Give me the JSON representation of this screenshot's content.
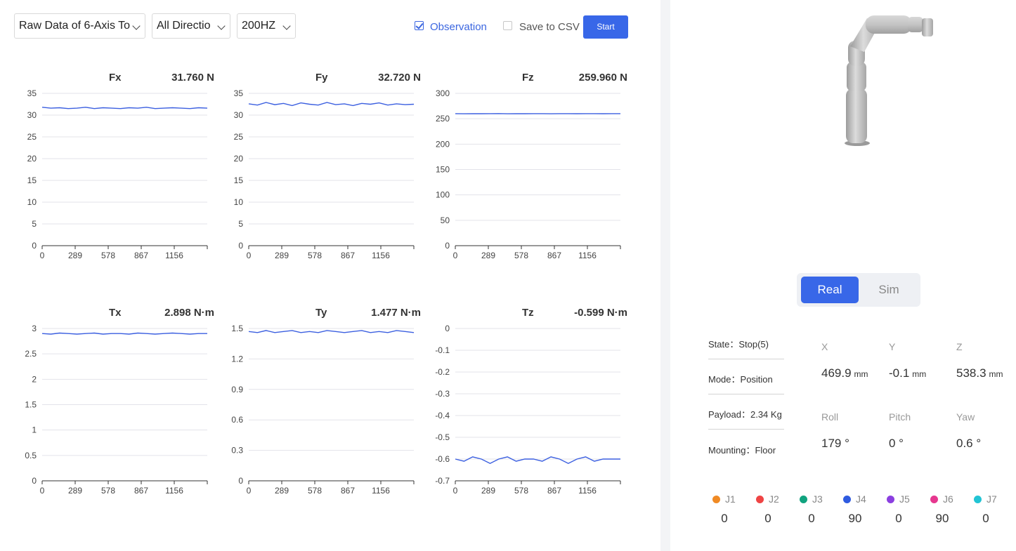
{
  "toolbar": {
    "data_select": "Raw Data of 6-Axis To",
    "direction_select": "All Directio",
    "rate_select": "200HZ",
    "observation_label": "Observation",
    "observation_checked": true,
    "save_csv_label": "Save to CSV",
    "save_csv_checked": false,
    "start_label": "Start"
  },
  "colors": {
    "accent": "#3867e8",
    "line": "#3b5fe0"
  },
  "chart_data": [
    {
      "type": "line",
      "title": "Fx",
      "value_label": "31.760 N",
      "ylim": [
        0,
        35
      ],
      "yticks": [
        "35",
        "30",
        "25",
        "20",
        "15",
        "10",
        "5",
        "0"
      ],
      "xticks": [
        "0",
        "289",
        "578",
        "867",
        "1156"
      ],
      "xmax": 1445,
      "series": [
        {
          "values": [
            31.8,
            31.6,
            31.7,
            31.5,
            31.6,
            31.8,
            31.5,
            31.7,
            31.6,
            31.5,
            31.7,
            31.6,
            31.8,
            31.5,
            31.6,
            31.7,
            31.6,
            31.5,
            31.7,
            31.6
          ]
        }
      ]
    },
    {
      "type": "line",
      "title": "Fy",
      "value_label": "32.720 N",
      "ylim": [
        0,
        35
      ],
      "yticks": [
        "35",
        "30",
        "25",
        "20",
        "15",
        "10",
        "5",
        "0"
      ],
      "xticks": [
        "0",
        "289",
        "578",
        "867",
        "1156"
      ],
      "xmax": 1445,
      "series": [
        {
          "values": [
            32.6,
            32.3,
            32.9,
            32.4,
            32.7,
            32.2,
            32.8,
            32.5,
            32.3,
            32.9,
            32.4,
            32.6,
            32.2,
            32.7,
            32.5,
            32.8,
            32.3,
            32.6,
            32.4,
            32.5
          ]
        }
      ]
    },
    {
      "type": "line",
      "title": "Fz",
      "value_label": "259.960 N",
      "ylim": [
        0,
        300
      ],
      "yticks": [
        "300",
        "250",
        "200",
        "150",
        "100",
        "50",
        "0"
      ],
      "xticks": [
        "0",
        "289",
        "578",
        "867",
        "1156"
      ],
      "xmax": 1445,
      "series": [
        {
          "values": [
            260,
            259.8,
            260.1,
            259.9,
            260,
            260.2,
            259.8,
            260,
            259.9,
            260.1,
            260,
            259.8,
            260,
            260.1,
            259.9,
            260,
            260.1,
            259.9,
            260,
            260
          ]
        }
      ]
    },
    {
      "type": "line",
      "title": "Tx",
      "value_label": "2.898 N·m",
      "ylim": [
        0,
        3
      ],
      "yticks": [
        "3",
        "2.5",
        "2",
        "1.5",
        "1",
        "0.5",
        "0"
      ],
      "xticks": [
        "0",
        "289",
        "578",
        "867",
        "1156"
      ],
      "xmax": 1445,
      "series": [
        {
          "values": [
            2.9,
            2.89,
            2.91,
            2.9,
            2.89,
            2.9,
            2.91,
            2.89,
            2.9,
            2.9,
            2.89,
            2.91,
            2.9,
            2.89,
            2.9,
            2.91,
            2.9,
            2.89,
            2.9,
            2.9
          ]
        }
      ]
    },
    {
      "type": "line",
      "title": "Ty",
      "value_label": "1.477 N·m",
      "ylim": [
        0,
        1.5
      ],
      "yticks": [
        "1.5",
        "1.2",
        "0.9",
        "0.6",
        "0.3",
        "0"
      ],
      "xticks": [
        "0",
        "289",
        "578",
        "867",
        "1156"
      ],
      "xmax": 1445,
      "series": [
        {
          "values": [
            1.47,
            1.46,
            1.48,
            1.46,
            1.47,
            1.48,
            1.46,
            1.47,
            1.46,
            1.48,
            1.47,
            1.46,
            1.47,
            1.48,
            1.46,
            1.47,
            1.46,
            1.48,
            1.47,
            1.46
          ]
        }
      ]
    },
    {
      "type": "line",
      "title": "Tz",
      "value_label": "-0.599 N·m",
      "ylim": [
        -0.7,
        0
      ],
      "yticks": [
        "0",
        "-0.1",
        "-0.2",
        "-0.3",
        "-0.4",
        "-0.5",
        "-0.6",
        "-0.7"
      ],
      "xticks": [
        "0",
        "289",
        "578",
        "867",
        "1156"
      ],
      "xmax": 1445,
      "series": [
        {
          "values": [
            -0.6,
            -0.61,
            -0.59,
            -0.6,
            -0.62,
            -0.6,
            -0.59,
            -0.61,
            -0.6,
            -0.6,
            -0.61,
            -0.59,
            -0.6,
            -0.62,
            -0.6,
            -0.59,
            -0.61,
            -0.6,
            -0.6,
            -0.6
          ]
        }
      ]
    }
  ],
  "mode_toggle": {
    "real_label": "Real",
    "sim_label": "Sim",
    "selected": "Real"
  },
  "status": {
    "state": "State：Stop(5)",
    "mode": "Mode：Position",
    "payload": "Payload：2.34 Kg",
    "mounting": "Mounting：Floor"
  },
  "pose": {
    "x_label": "X",
    "x_value": "469.9",
    "x_unit": "mm",
    "y_label": "Y",
    "y_value": "-0.1",
    "y_unit": "mm",
    "z_label": "Z",
    "z_value": "538.3",
    "z_unit": "mm",
    "roll_label": "Roll",
    "roll_value": "179 °",
    "pitch_label": "Pitch",
    "pitch_value": "0 °",
    "yaw_label": "Yaw",
    "yaw_value": "0.6 °"
  },
  "joints": [
    {
      "label": "J1",
      "value": "0",
      "color": "#f08a24"
    },
    {
      "label": "J2",
      "value": "0",
      "color": "#ef4444"
    },
    {
      "label": "J3",
      "value": "0",
      "color": "#10a37f"
    },
    {
      "label": "J4",
      "value": "90",
      "color": "#2f5be0"
    },
    {
      "label": "J5",
      "value": "0",
      "color": "#8b3fe0"
    },
    {
      "label": "J6",
      "value": "90",
      "color": "#e6378f"
    },
    {
      "label": "J7",
      "value": "0",
      "color": "#22c4d4"
    }
  ]
}
